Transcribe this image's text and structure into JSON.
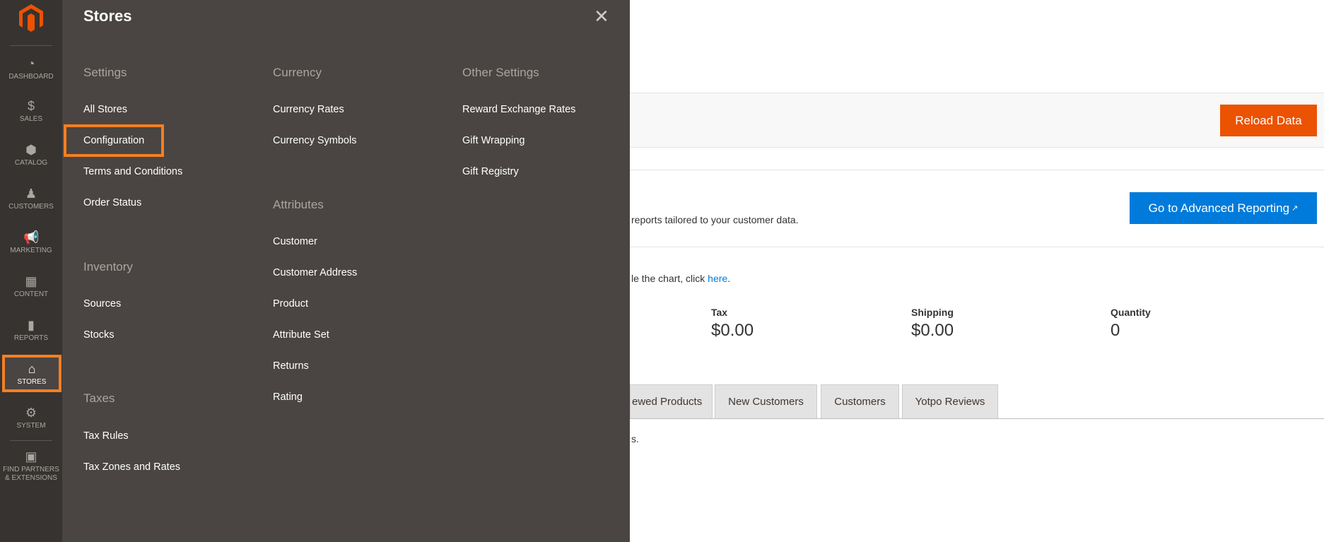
{
  "sidebar": {
    "items": [
      {
        "label": "DASHBOARD",
        "icon": "dashboard-icon"
      },
      {
        "label": "SALES",
        "icon": "dollar-icon"
      },
      {
        "label": "CATALOG",
        "icon": "box-icon"
      },
      {
        "label": "CUSTOMERS",
        "icon": "person-icon"
      },
      {
        "label": "MARKETING",
        "icon": "megaphone-icon"
      },
      {
        "label": "CONTENT",
        "icon": "layout-icon"
      },
      {
        "label": "REPORTS",
        "icon": "bar-chart-icon"
      },
      {
        "label": "STORES",
        "icon": "storefront-icon"
      },
      {
        "label": "SYSTEM",
        "icon": "gear-icon"
      },
      {
        "label": "FIND PARTNERS & EXTENSIONS",
        "icon": "blocks-icon"
      }
    ],
    "active": "STORES"
  },
  "panel": {
    "title": "Stores",
    "columns": [
      {
        "groups": [
          {
            "heading": "Settings",
            "items": [
              "All Stores",
              "Configuration",
              "Terms and Conditions",
              "Order Status"
            ]
          },
          {
            "heading": "Inventory",
            "items": [
              "Sources",
              "Stocks"
            ]
          },
          {
            "heading": "Taxes",
            "items": [
              "Tax Rules",
              "Tax Zones and Rates"
            ]
          }
        ]
      },
      {
        "groups": [
          {
            "heading": "Currency",
            "items": [
              "Currency Rates",
              "Currency Symbols"
            ]
          },
          {
            "heading": "Attributes",
            "items": [
              "Customer",
              "Customer Address",
              "Product",
              "Attribute Set",
              "Returns",
              "Rating"
            ]
          }
        ]
      },
      {
        "groups": [
          {
            "heading": "Other Settings",
            "items": [
              "Reward Exchange Rates",
              "Gift Wrapping",
              "Gift Registry"
            ]
          }
        ]
      }
    ],
    "highlighted": "Configuration"
  },
  "main": {
    "reload_label": "Reload Data",
    "advanced_text": "reports tailored to your customer data.",
    "advanced_button": "Go to Advanced Reporting",
    "chart_text": "le the chart, click ",
    "chart_link": "here",
    "chart_end": ".",
    "stats": [
      {
        "label": "Tax",
        "value": "$0.00"
      },
      {
        "label": "Shipping",
        "value": "$0.00"
      },
      {
        "label": "Quantity",
        "value": "0"
      }
    ],
    "tabs": [
      "ewed Products",
      "New Customers",
      "Customers",
      "Yotpo Reviews"
    ],
    "tab_text": "s.",
    "colors": {
      "orange": "#eb5202",
      "blue": "#007bdb",
      "highlight": "#f47f22"
    }
  }
}
